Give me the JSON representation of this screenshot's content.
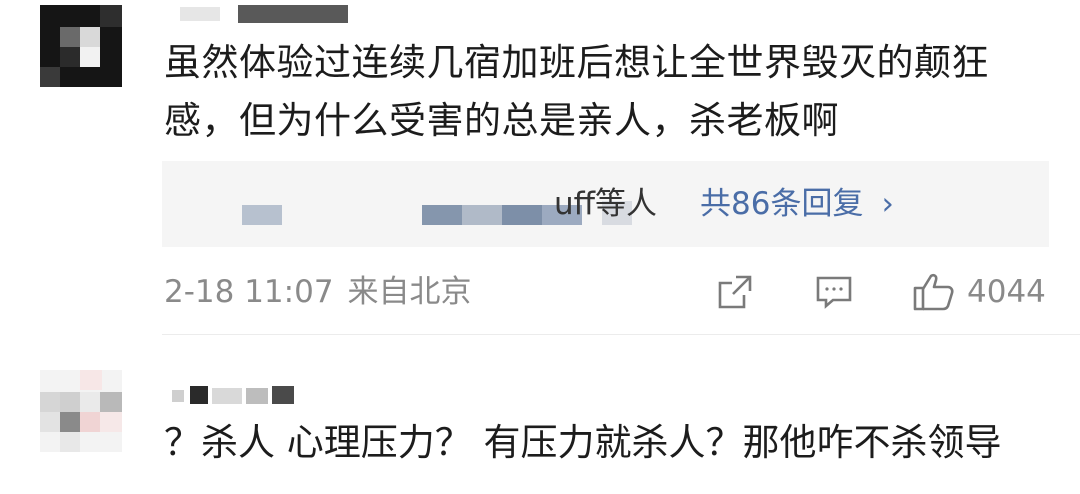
{
  "comment1": {
    "text_line1": "虽然体验过连续几宿加班后想让全世界毁灭的颠狂",
    "text_line2": "感，但为什么受害的总是亲人，杀老板啊",
    "reply_preview": "uff等人",
    "reply_count_label": "共86条回复",
    "reply_chevron": "›",
    "timestamp": "2-18 11:07",
    "location": "来自北京",
    "like_count": "4044"
  },
  "comment2": {
    "text": "？杀人 心理压力？ 有压力就杀人？那他咋不杀领导"
  },
  "icons": {
    "share": "share-icon",
    "comment": "comment-icon",
    "like": "thumbs-up-icon"
  },
  "colors": {
    "link": "#4a6da7",
    "meta": "#8a8a8a",
    "reply_bg": "#f5f5f5"
  }
}
